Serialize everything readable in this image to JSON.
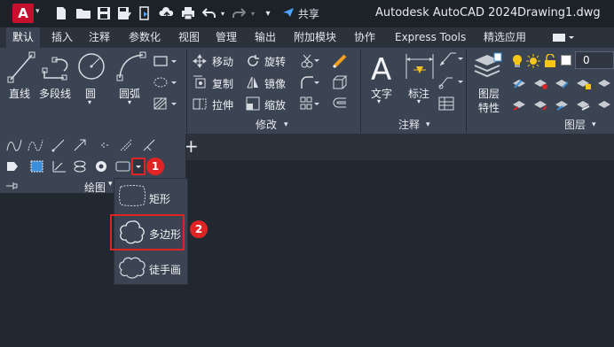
{
  "window": {
    "app_title": "Autodesk AutoCAD 2024",
    "file_title": "Drawing1.dwg",
    "logo_letter": "A",
    "share_label": "共享"
  },
  "tabs": [
    {
      "label": "默认",
      "active": true
    },
    {
      "label": "插入"
    },
    {
      "label": "注释"
    },
    {
      "label": "参数化"
    },
    {
      "label": "视图"
    },
    {
      "label": "管理"
    },
    {
      "label": "输出"
    },
    {
      "label": "附加模块"
    },
    {
      "label": "协作"
    },
    {
      "label": "Express Tools"
    },
    {
      "label": "精选应用"
    }
  ],
  "draw_panel": {
    "title": "绘图",
    "line": "直线",
    "polyline": "多段线",
    "circle": "圆",
    "arc": "圆弧"
  },
  "modify_panel": {
    "title": "修改",
    "move": "移动",
    "rotate": "旋转",
    "copy": "复制",
    "mirror": "镜像",
    "stretch": "拉伸",
    "scale": "缩放"
  },
  "annotation_panel": {
    "title": "注释",
    "text": "文字",
    "dimension": "标注"
  },
  "layers_panel": {
    "title": "图层",
    "layer_props_line1": "图层",
    "layer_props_line2": "特性",
    "current_layer": "0"
  },
  "rect_dropdown": {
    "items": [
      {
        "label": "矩形"
      },
      {
        "label": "多边形"
      },
      {
        "label": "徒手画"
      }
    ]
  },
  "callouts": [
    "1",
    "2"
  ],
  "colors": {
    "ribbon_bg": "#3b4453",
    "title_bg": "#1d2229",
    "canvas_bg": "#212830",
    "accent_red": "#e02424",
    "share_blue": "#4aa3ff"
  }
}
